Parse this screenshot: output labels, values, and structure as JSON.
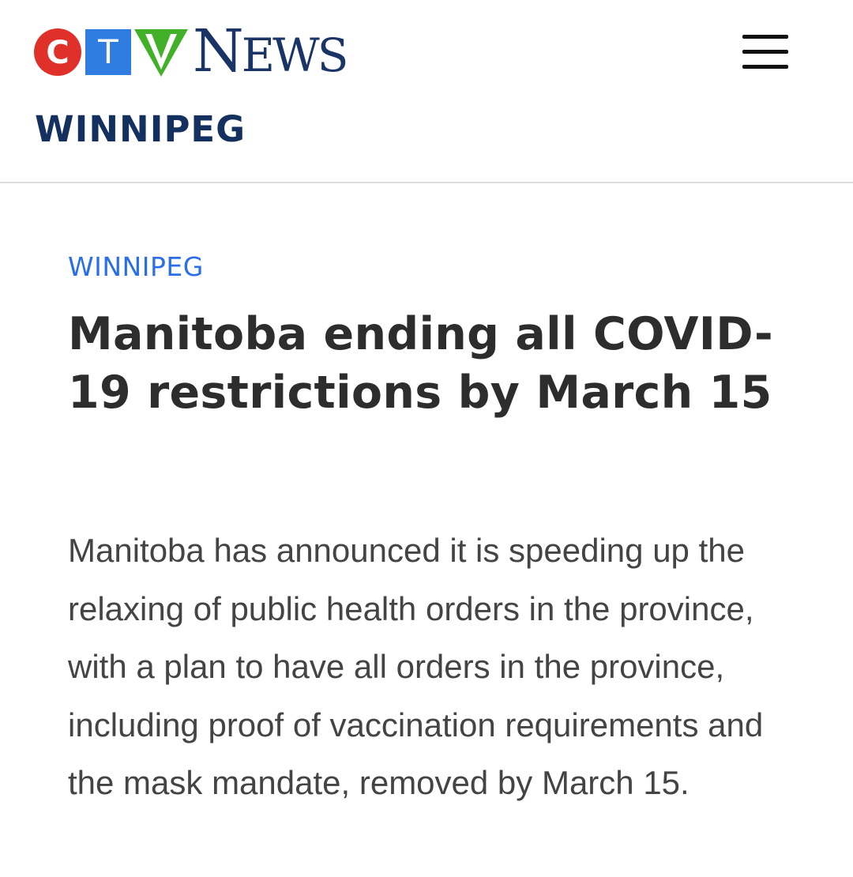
{
  "header": {
    "logo": {
      "letters": [
        "C",
        "T",
        "V"
      ],
      "word": "NEWS",
      "colors": {
        "c": "#e0302a",
        "t": "#2f7de1",
        "v": "#43b02a",
        "word": "#1b3466"
      }
    },
    "menu_icon": "hamburger-menu-icon",
    "section_title": "WINNIPEG"
  },
  "article": {
    "category": "WINNIPEG",
    "headline": "Manitoba ending all COVID-19 restrictions by March 15",
    "body": "Manitoba has announced it is speeding up the relaxing of public health orders in the province, with a plan to have all orders in the province, including proof of vaccination requirements and the mask mandate, removed by March 15."
  },
  "colors": {
    "section_title": "#13305f",
    "category": "#2a6ee8",
    "headline": "#2d2d2d",
    "body": "#444444",
    "divider": "#dcdcdc"
  }
}
